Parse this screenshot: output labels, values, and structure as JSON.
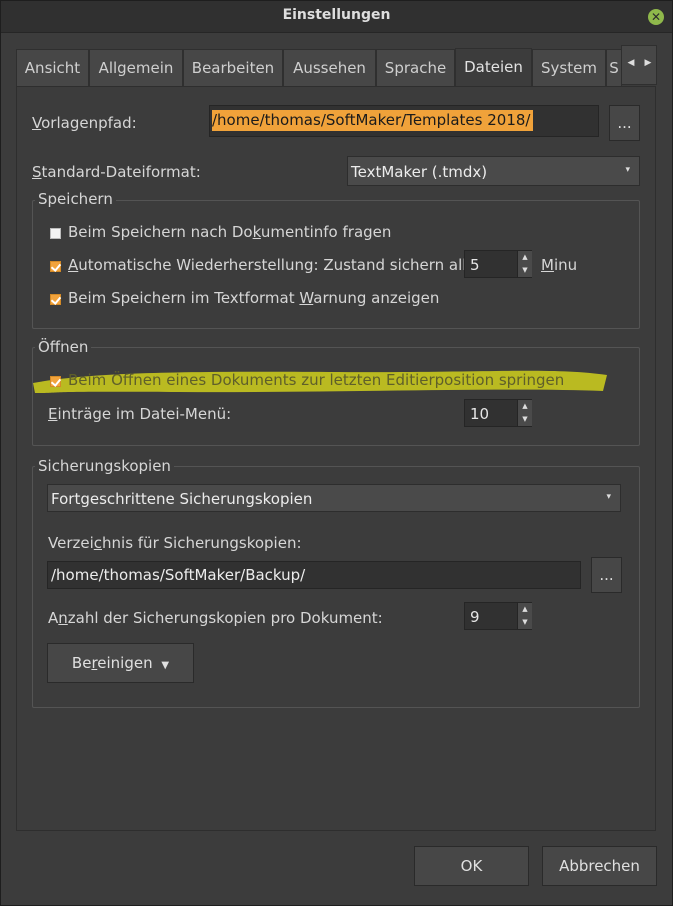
{
  "window": {
    "title": "Einstellungen"
  },
  "tabs": [
    {
      "label": "Ansicht"
    },
    {
      "label": "Allgemein"
    },
    {
      "label": "Bearbeiten"
    },
    {
      "label": "Aussehen"
    },
    {
      "label": "Sprache"
    },
    {
      "label": "Dateien"
    },
    {
      "label": "System"
    },
    {
      "label": "S"
    }
  ],
  "active_tab": "Dateien",
  "template_path": {
    "label_u": "V",
    "label_rest": "orlagenpfad:",
    "value": "/home/thomas/SoftMaker/Templates 2018/",
    "browse_label": "..."
  },
  "default_format": {
    "label_u": "S",
    "label_rest": "tandard-Dateiformat:",
    "value": "TextMaker (.tmdx)"
  },
  "save_group": {
    "title": "Speichern",
    "options": [
      {
        "pre": "Beim Speichern nach Do",
        "u": "k",
        "post": "umentinfo fragen",
        "checked": false
      },
      {
        "pre": "",
        "u": "A",
        "post": "utomatische Wiederherstellung: Zustand sichern alle",
        "checked": true
      },
      {
        "pre": "Beim Speichern im Textformat ",
        "u": "W",
        "post": "arnung anzeigen",
        "checked": true
      }
    ],
    "autosave_minutes": "5",
    "minutes_u": "M",
    "minutes_rest": "inu"
  },
  "open_group": {
    "title": "Öffnen",
    "option": {
      "label": "Beim Öffnen eines Dokuments zur letzten Editierposition springen",
      "checked": true
    },
    "recent_u": "E",
    "recent_rest": "inträge im Datei-Menü:",
    "recent_count": "10"
  },
  "backup_group": {
    "title": "Sicherungskopien",
    "mode": "Fortgeschrittene Sicherungskopien",
    "dir_pre": "Verzei",
    "dir_u": "c",
    "dir_post": "hnis für Sicherungskopien:",
    "dir_value": "/home/thomas/SoftMaker/Backup/",
    "browse_label": "...",
    "count_pre": "A",
    "count_u": "n",
    "count_post": "zahl der Sicherungskopien pro Dokument:",
    "count_value": "9",
    "cleanup_pre": "Be",
    "cleanup_u": "r",
    "cleanup_post": "einigen"
  },
  "footer": {
    "ok": "OK",
    "cancel": "Abbrechen"
  },
  "colors": {
    "highlight": "#c8c81e",
    "path_highlight": "#f0a23a",
    "checkbox": "#f2a33c"
  }
}
